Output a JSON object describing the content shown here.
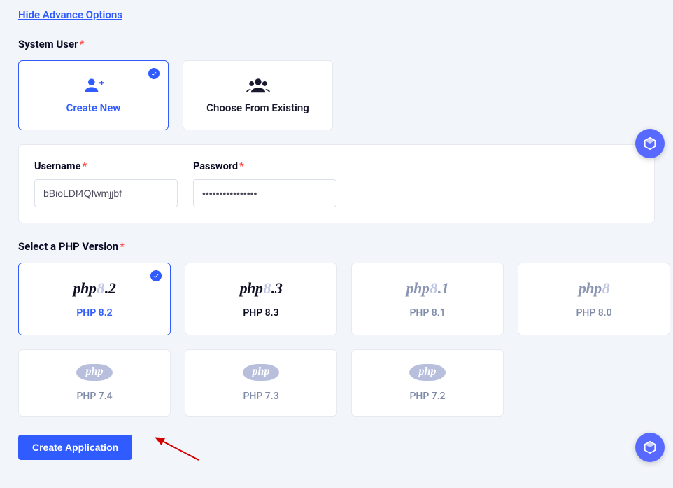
{
  "advance_link": "Hide Advance Options",
  "system_user": {
    "label": "System User",
    "create_new": "Create New",
    "choose_existing": "Choose From Existing"
  },
  "credentials": {
    "username_label": "Username",
    "username_value": "bBioLDf4Qfwmjjbf",
    "password_label": "Password",
    "password_value": "••••••••••••••••"
  },
  "php": {
    "label": "Select a PHP Version",
    "options": {
      "v82": "PHP 8.2",
      "v83": "PHP 8.3",
      "v81": "PHP 8.1",
      "v80": "PHP 8.0",
      "v74": "PHP 7.4",
      "v73": "PHP 7.3",
      "v72": "PHP 7.2"
    }
  },
  "create_btn": "Create Application"
}
